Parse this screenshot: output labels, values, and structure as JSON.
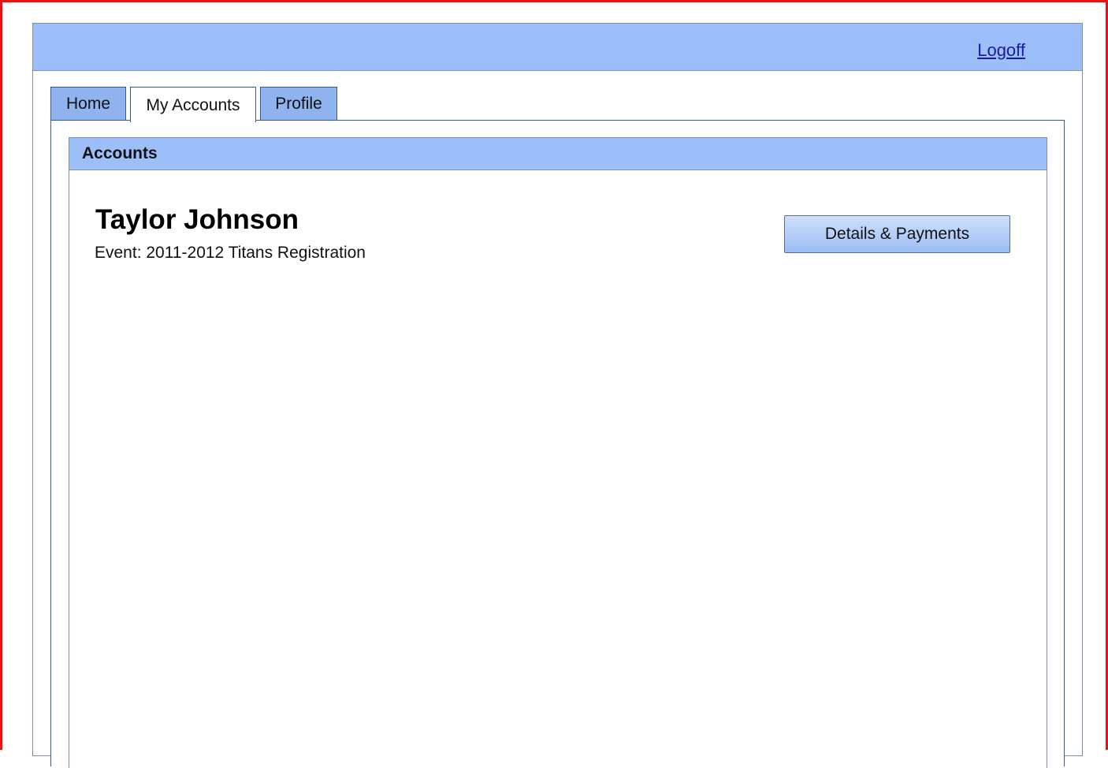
{
  "header": {
    "logoff_label": "Logoff"
  },
  "tabs": [
    {
      "label": "Home",
      "active": false
    },
    {
      "label": "My Accounts",
      "active": true
    },
    {
      "label": "Profile",
      "active": false
    }
  ],
  "accounts": {
    "title": "Accounts",
    "entry": {
      "name": "Taylor Johnson",
      "event": "Event: 2011-2012 Titans Registration",
      "button_label": "Details & Payments"
    }
  },
  "colors": {
    "frame_border": "#ee1111",
    "header_bg": "#9dbff9",
    "tab_bg": "#8fb3ef",
    "link": "#1a1aa6"
  }
}
